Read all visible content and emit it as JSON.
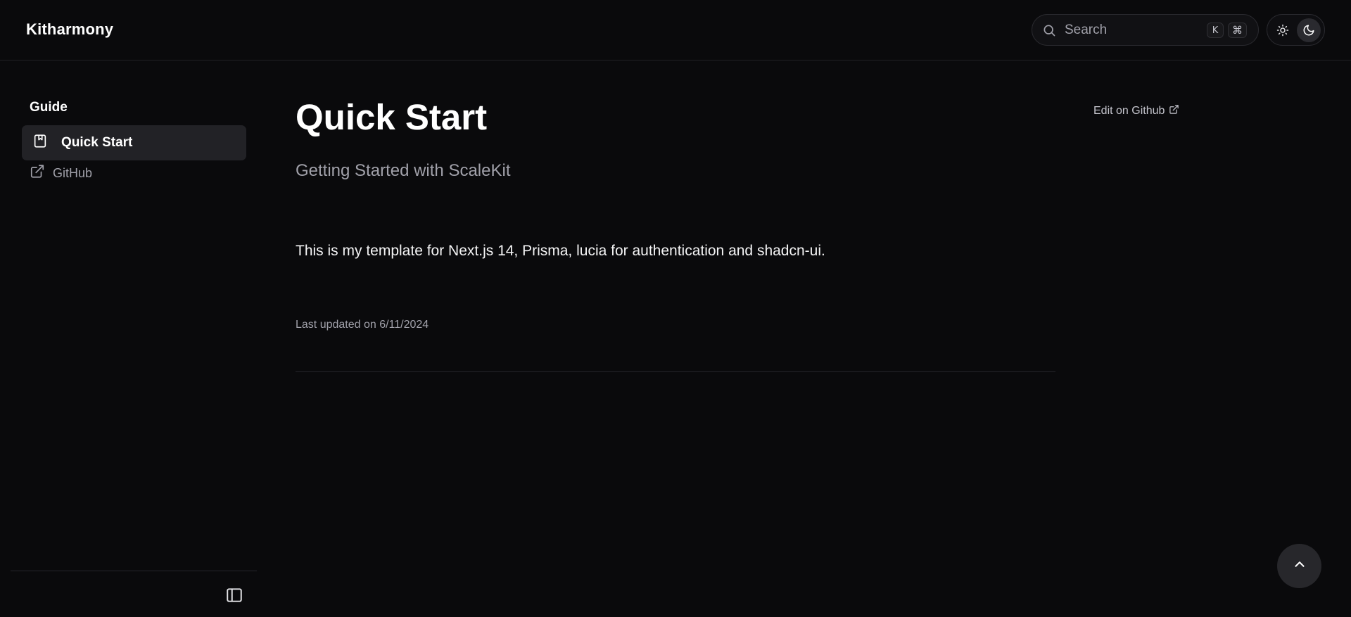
{
  "header": {
    "brand": "Kitharmony",
    "search": {
      "placeholder": "Search",
      "kbd_k": "K",
      "kbd_cmd": "⌘",
      "icon": "search-icon"
    },
    "theme_toggle": {
      "light_icon": "sun-icon",
      "dark_icon": "moon-icon",
      "selected": "dark"
    }
  },
  "sidebar": {
    "group_title": "Guide",
    "items": [
      {
        "label": "Quick Start",
        "icon": "book-icon",
        "active": true
      },
      {
        "label": "GitHub",
        "icon": "external-link-icon",
        "active": false
      }
    ],
    "footer_icon": "sidebar-toggle-icon"
  },
  "main": {
    "title": "Quick Start",
    "description": "Getting Started with ScaleKit",
    "body": "This is my template for Next.js 14, Prisma, lucia for authentication and shadcn-ui.",
    "last_updated": "Last updated on 6/11/2024"
  },
  "toc": {
    "edit_label": "Edit on Github",
    "edit_icon": "external-link-icon"
  },
  "scroll_top_icon": "chevron-up-icon",
  "colors": {
    "background": "#0a0a0c",
    "active_item": "#222226",
    "muted_text": "#a1a1aa",
    "border": "#26262b"
  }
}
